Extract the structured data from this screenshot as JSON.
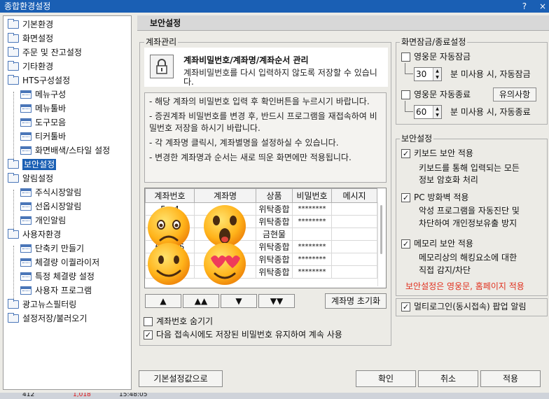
{
  "window": {
    "title": "종합환경설정",
    "help": "?",
    "close": "×"
  },
  "tree": {
    "items": [
      {
        "label": "기본환경",
        "kind": "folder"
      },
      {
        "label": "화면설정",
        "kind": "folder"
      },
      {
        "label": "주문 및 잔고설정",
        "kind": "folder"
      },
      {
        "label": "기타환경",
        "kind": "folder"
      },
      {
        "label": "HTS구성설정",
        "kind": "folder"
      },
      {
        "label": "메뉴구성",
        "kind": "doc"
      },
      {
        "label": "메뉴툴바",
        "kind": "doc"
      },
      {
        "label": "도구모음",
        "kind": "doc"
      },
      {
        "label": "티커툴바",
        "kind": "doc"
      },
      {
        "label": "화면배색/스타일 설정",
        "kind": "doc"
      },
      {
        "label": "보안설정",
        "kind": "folder"
      },
      {
        "label": "알림설정",
        "kind": "folder"
      },
      {
        "label": "주식시장알림",
        "kind": "doc"
      },
      {
        "label": "선옵시장알림",
        "kind": "doc"
      },
      {
        "label": "개인알림",
        "kind": "doc"
      },
      {
        "label": "사용자환경",
        "kind": "folder"
      },
      {
        "label": "단축키 만들기",
        "kind": "doc"
      },
      {
        "label": "체결량 이퀄라이저",
        "kind": "doc"
      },
      {
        "label": "특정 체결량 설정",
        "kind": "doc"
      },
      {
        "label": "사용자 프로그램",
        "kind": "doc"
      },
      {
        "label": "광고뉴스필터링",
        "kind": "folder"
      },
      {
        "label": "설정저장/불러오기",
        "kind": "folder"
      }
    ],
    "selected": "보안설정"
  },
  "header": {
    "title": "보안설정"
  },
  "account": {
    "group_title": "계좌관리",
    "info_title": "계좌비밀번호/계좌명/계좌순서 관리",
    "info_desc": "계좌비밀번호를 다시 입력하지 않도록 저장할 수 있습니다.",
    "notes": [
      "- 해당 계좌의 비밀번호 입력 후 확인버튼을 누르시기 바랍니다.",
      "- 증권계좌 비밀번호를 변경 후, 반드시 프로그램을 재접속하여 비밀번호 저장을 하시기 바랍니다.",
      "- 각 계좌명 클릭시, 계좌별명을 설정하실 수 있습니다.",
      "- 변경한 계좌명과 순서는 새로 띄운 화면에만 적용됩니다."
    ],
    "columns": [
      "계좌번호",
      "계좌명",
      "상품",
      "비밀번호",
      "메시지"
    ],
    "rows": [
      {
        "no": "5...4",
        "name": "",
        "product": "위탁종합",
        "pw": "********",
        "msg": ""
      },
      {
        "no": "",
        "name": "",
        "product": "위탁종합",
        "pw": "********",
        "msg": ""
      },
      {
        "no": "",
        "name": "",
        "product": "금현물",
        "pw": "",
        "msg": ""
      },
      {
        "no": "60...85",
        "name": "",
        "product": "위탁종합",
        "pw": "********",
        "msg": ""
      },
      {
        "no": "",
        "name": "",
        "product": "위탁종합",
        "pw": "********",
        "msg": ""
      },
      {
        "no": "",
        "name": "",
        "product": "위탁종합",
        "pw": "********",
        "msg": ""
      }
    ],
    "move_buttons": [
      "▲",
      "▲▲",
      "▼",
      "▼▼"
    ],
    "reset_button": "계좌명 초기화",
    "hide_account_no": "계좌번호 숨기기",
    "hide_checked": false,
    "keep_password": "다음 접속시에도 저장된 비밀번호 유지하여 계속 사용",
    "keep_checked": true
  },
  "screen_lock": {
    "group_title": "화면잠금/종료설정",
    "auto_lock_label": "영웅문 자동잠금",
    "auto_lock_checked": false,
    "lock_minutes": "30",
    "lock_suffix": "분 미사용 시, 자동잠금",
    "auto_exit_label": "영웅문 자동종료",
    "auto_exit_checked": false,
    "notice_button": "유의사항",
    "exit_minutes": "60",
    "exit_suffix": "분 미사용 시, 자동종료"
  },
  "security": {
    "group_title": "보안설정",
    "options": [
      {
        "label": "키보드 보안 적용",
        "desc": [
          "키보드를 통해 입력되는 모든",
          "정보 암호화 처리"
        ],
        "checked": true
      },
      {
        "label": "PC 방화벽 적용",
        "desc": [
          "악성 프로그램을 자동진단 및",
          "차단하여 개인정보유출 방지"
        ],
        "checked": true
      },
      {
        "label": "메모리 보안 적용",
        "desc": [
          "메모리상의 해킹요소에 대한",
          "직접 감지/차단"
        ],
        "checked": true
      }
    ],
    "note": "보안설정은 영웅문, 홈페이지 적용",
    "note_color": "#e0301e",
    "multilogin_label": "멀티로그인(동시접속) 팝업 알림",
    "multilogin_checked": true
  },
  "footer": {
    "defaults": "기본설정값으로",
    "ok": "확인",
    "cancel": "취소",
    "apply": "적용"
  },
  "background_strip": {
    "cell1": "412",
    "cell2": "1,018",
    "time": "15:48:05"
  }
}
